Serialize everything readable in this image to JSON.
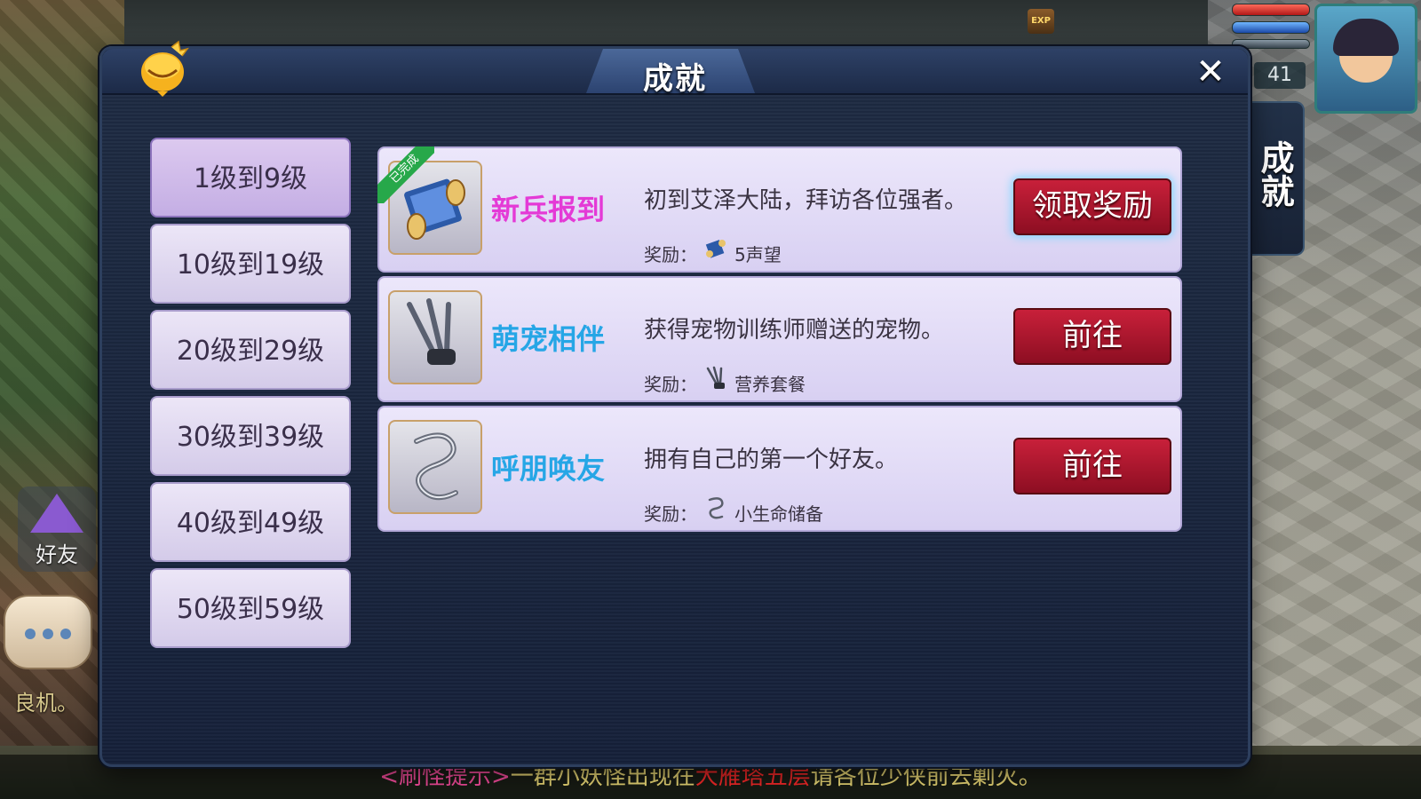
{
  "dialog": {
    "title": "成就",
    "close_glyph": "✕"
  },
  "level_tabs": [
    {
      "label": "1级到9级",
      "active": true
    },
    {
      "label": "10级到19级"
    },
    {
      "label": "20级到29级"
    },
    {
      "label": "30级到39级"
    },
    {
      "label": "40级到49级"
    },
    {
      "label": "50级到59级"
    }
  ],
  "achievements": [
    {
      "icon": "scroll-icon",
      "badge": "已完成",
      "name": "新兵报到",
      "name_color": "#e43ad6",
      "description": "初到艾泽大陆，拜访各位强者。",
      "reward_label": "奖励：",
      "reward_icon": "scroll-icon",
      "reward": "5声望",
      "button": "领取奖励"
    },
    {
      "icon": "claws-icon",
      "name": "萌宠相伴",
      "name_color": "#26a6e6",
      "description": "获得宠物训练师赠送的宠物。",
      "reward_label": "奖励：",
      "reward_icon": "claws-icon",
      "reward": "营养套餐",
      "button": "前往"
    },
    {
      "icon": "ribbon-icon",
      "name": "呼朋唤友",
      "name_color": "#26a6e6",
      "description": "拥有自己的第一个好友。",
      "reward_label": "奖励：",
      "reward_icon": "ribbon-icon",
      "reward": "小生命储备",
      "button": "前往"
    }
  ],
  "side_tab": {
    "label": "成就"
  },
  "hud": {
    "level": "41",
    "exp_badge": "EXP"
  },
  "friend_button": {
    "label": "好友"
  },
  "chat_snippet": "良机。",
  "ticker": {
    "tag": "<刷怪提示>",
    "text_before": "一群小妖怪出现在",
    "location": "大雁塔五层",
    "text_after": "请各位少侠前去剿灭。"
  },
  "colors": {
    "button_red": "#c8203a",
    "tab_lavender": "#d4cbe9",
    "dialog_navy": "#1f2c44",
    "ticker_tag": "#ff4fa3",
    "ticker_location": "#ff2a2a",
    "ticker_text": "#f3e07a"
  }
}
